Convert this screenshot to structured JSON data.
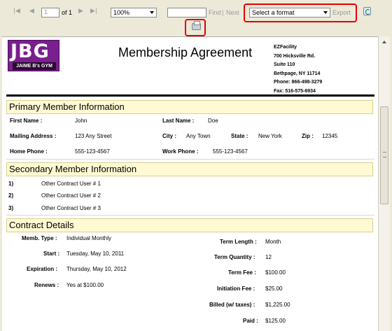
{
  "toolbar": {
    "page_value": "1",
    "page_of": "of 1",
    "zoom": "100%",
    "find_label": "Find",
    "separator": "|",
    "next_label": "Next",
    "format_select": "Select a format",
    "export_label": "Export"
  },
  "header": {
    "logo_text": "JBG",
    "logo_subtext": "JAIME B's GYM",
    "title": "Membership Agreement",
    "company": [
      "EZFacility",
      "700 Hicksville Rd.",
      "Suite 110",
      "Bethpage, NY 11714",
      "Phone: 866-498-3279",
      "Fax: 516-575-6934"
    ]
  },
  "primary": {
    "heading": "Primary Member Information",
    "first_name_label": "First Name :",
    "first_name": "John",
    "last_name_label": "Last Name :",
    "last_name": "Doe",
    "address_label": "Mailing Address :",
    "address": "123 Any Street",
    "city_label": "City :",
    "city": "Any Town",
    "state_label": "State :",
    "state": "New York",
    "zip_label": "Zip :",
    "zip": "12345",
    "home_phone_label": "Home Phone :",
    "home_phone": "555-123-4567",
    "work_phone_label": "Work Phone :",
    "work_phone": "555-123-4567"
  },
  "secondary": {
    "heading": "Secondary Member Information",
    "users": [
      {
        "num": "1)",
        "name": "Other Contract User # 1"
      },
      {
        "num": "2)",
        "name": "Other Contract User # 2"
      },
      {
        "num": "3)",
        "name": "Other Contract User # 3"
      }
    ]
  },
  "contract": {
    "heading": "Contract Details",
    "memb_type_label": "Memb. Type :",
    "memb_type": "Individual Monthly",
    "start_label": "Start :",
    "start": "Tuesday, May 10, 2011",
    "expiration_label": "Expiration :",
    "expiration": "Thursday, May 10, 2012",
    "renews_label": "Renews :",
    "renews": "Yes at $100.00",
    "term_length_label": "Term Length :",
    "term_length": "Month",
    "term_quantity_label": "Term Quantity :",
    "term_quantity": "12",
    "term_fee_label": "Term Fee :",
    "term_fee": "$100.00",
    "initiation_fee_label": "Initiation Fee :",
    "initiation_fee": "$25.00",
    "billed_label": "Billed (w/ taxes) :",
    "billed": "$1,225.00",
    "paid_label": "Paid :",
    "paid": "$125.00"
  }
}
